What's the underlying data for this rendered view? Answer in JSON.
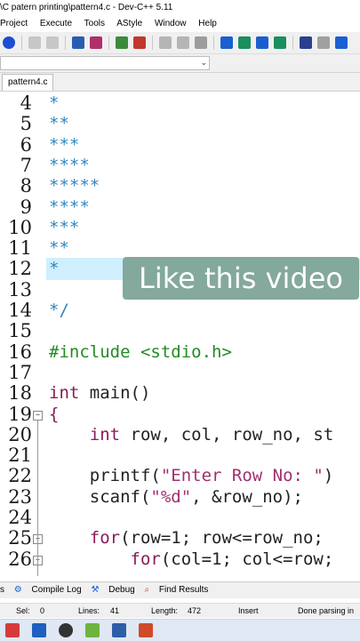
{
  "window": {
    "title": "\\C patern printing\\pattern4.c - Dev-C++ 5.11"
  },
  "menu": [
    "Project",
    "Execute",
    "Tools",
    "AStyle",
    "Window",
    "Help"
  ],
  "tabs": {
    "active": "pattern4.c"
  },
  "editor": {
    "lines": [
      {
        "n": "4",
        "text": "*",
        "cls": "comment"
      },
      {
        "n": "5",
        "text": "**",
        "cls": "comment"
      },
      {
        "n": "6",
        "text": "***",
        "cls": "comment"
      },
      {
        "n": "7",
        "text": "****",
        "cls": "comment"
      },
      {
        "n": "8",
        "text": "*****",
        "cls": "comment"
      },
      {
        "n": "9",
        "text": "****",
        "cls": "comment"
      },
      {
        "n": "10",
        "text": "***",
        "cls": "comment"
      },
      {
        "n": "11",
        "text": "**",
        "cls": "comment"
      },
      {
        "n": "12",
        "text": "*",
        "cls": "comment"
      },
      {
        "n": "13",
        "text": "",
        "cls": ""
      },
      {
        "n": "14",
        "text": "*/",
        "cls": "comment"
      },
      {
        "n": "15",
        "text": "",
        "cls": ""
      },
      {
        "n": "16",
        "text": "#include <stdio.h>",
        "cls": "pre"
      },
      {
        "n": "17",
        "text": "",
        "cls": ""
      },
      {
        "n": "18",
        "text": "int main()",
        "cls": "kwline"
      },
      {
        "n": "19",
        "text": "{",
        "cls": "kw"
      },
      {
        "n": "20",
        "text": "    int row, col, row_no, st",
        "cls": "kwline"
      },
      {
        "n": "21",
        "text": "",
        "cls": ""
      },
      {
        "n": "22",
        "text": "    printf(\"Enter Row No: \")",
        "cls": "str"
      },
      {
        "n": "23",
        "text": "    scanf(\"%d\", &row_no);",
        "cls": "str"
      },
      {
        "n": "24",
        "text": "",
        "cls": ""
      },
      {
        "n": "25",
        "text": "    for(row=1; row<=row_no;",
        "cls": "kwline"
      },
      {
        "n": "26",
        "text": "        for(col=1; col<=row;",
        "cls": "kwline"
      }
    ]
  },
  "overlay": {
    "banner": "Like this video"
  },
  "bottom_tabs": [
    "s",
    "Compile Log",
    "Debug",
    "Find Results"
  ],
  "status": {
    "sel_label": "Sel:",
    "sel_value": "0",
    "lines_label": "Lines:",
    "lines_value": "41",
    "length_label": "Length:",
    "length_value": "472",
    "mode": "Insert",
    "message": "Done parsing in"
  },
  "colors": {
    "comment": "#2e86c1",
    "preprocessor": "#228b22",
    "keyword": "#8b1a5a",
    "banner": "#7fa597"
  }
}
